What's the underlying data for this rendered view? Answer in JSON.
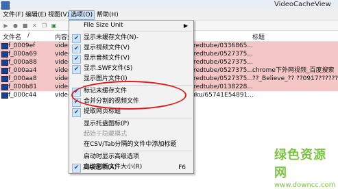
{
  "window": {
    "title": "VideoCacheView"
  },
  "menubar": [
    {
      "label": "文件(F)",
      "active": false
    },
    {
      "label": "编辑(E)",
      "active": false
    },
    {
      "label": "视图(V)",
      "active": false
    },
    {
      "label": "选项(O)",
      "active": true
    },
    {
      "label": "帮助(H)",
      "active": false
    }
  ],
  "toolbar": [
    "play",
    "record",
    "stop",
    "delete",
    "copy",
    "save"
  ],
  "table": {
    "columns": [
      "文件名",
      "内容类",
      "标题"
    ],
    "rows": [
      {
        "name": "f_0009ef",
        "type": "video",
        "url": "/redtube/0336865...",
        "title": "",
        "highlight": true
      },
      {
        "name": "f_000a69",
        "type": "video",
        "url": "/redtube/0527375...",
        "title": "",
        "highlight": true
      },
      {
        "name": "f_000a88",
        "type": "video",
        "url": "/redtube/0527375...",
        "title": "",
        "highlight": true
      },
      {
        "name": "f_000aa4",
        "type": "video",
        "url": "/redtube/0527375...",
        "title": "chrome下外网视频_百度搜索",
        "highlight": true
      },
      {
        "name": "f_000aa8",
        "type": "video",
        "url": "/redtube/0527375...",
        "title": "??_Believe_?? ??0917???????????",
        "highlight": true
      },
      {
        "name": "f_000b81",
        "type": "video",
        "url": "/redtube/0138228...",
        "title": "",
        "highlight": true
      },
      {
        "name": "f_000c44",
        "type": "video",
        "url": "uku/65741E54891...",
        "title": "",
        "highlight": false
      }
    ]
  },
  "options_menu": [
    {
      "label": "File Size Unit",
      "checked": false,
      "submenu": true
    },
    {
      "sep": true
    },
    {
      "label": "显示未缓存文件(N)-",
      "checked": true
    },
    {
      "label": "显示视频文件(V)",
      "checked": true
    },
    {
      "label": "显示音频文件(V)",
      "checked": true
    },
    {
      "label": "显示.SWF文件(S)",
      "checked": true
    },
    {
      "label": "显示图片文件(I)",
      "checked": false
    },
    {
      "sep": true
    },
    {
      "label": "标记未缓存文件",
      "checked": true
    },
    {
      "label": "合并分割的视频文件",
      "checked": true
    },
    {
      "label": "提取网页标题",
      "checked": true
    },
    {
      "sep": true
    },
    {
      "label": "显示托盘图标(P)",
      "checked": false
    },
    {
      "label": "起始于隐藏模式",
      "checked": false,
      "disabled": true
    },
    {
      "label": "在CSV/Tab分隔的文件中添加标题",
      "checked": false
    },
    {
      "sep": true
    },
    {
      "label": "启动时显示高级选项",
      "checked": false
    },
    {
      "label": "自动刷新文件大小(R)",
      "checked": true
    },
    {
      "label": "高级选项(A)",
      "checked": false,
      "shortcut": "F6"
    }
  ],
  "watermark": {
    "text": "绿色资源网",
    "url": "www.downcc.com"
  },
  "colors": {
    "highlight_row": "#f5c6c6",
    "annotation": "#e31a1a",
    "watermark": "#7cc242",
    "menu_active": "#cfe3fb"
  }
}
